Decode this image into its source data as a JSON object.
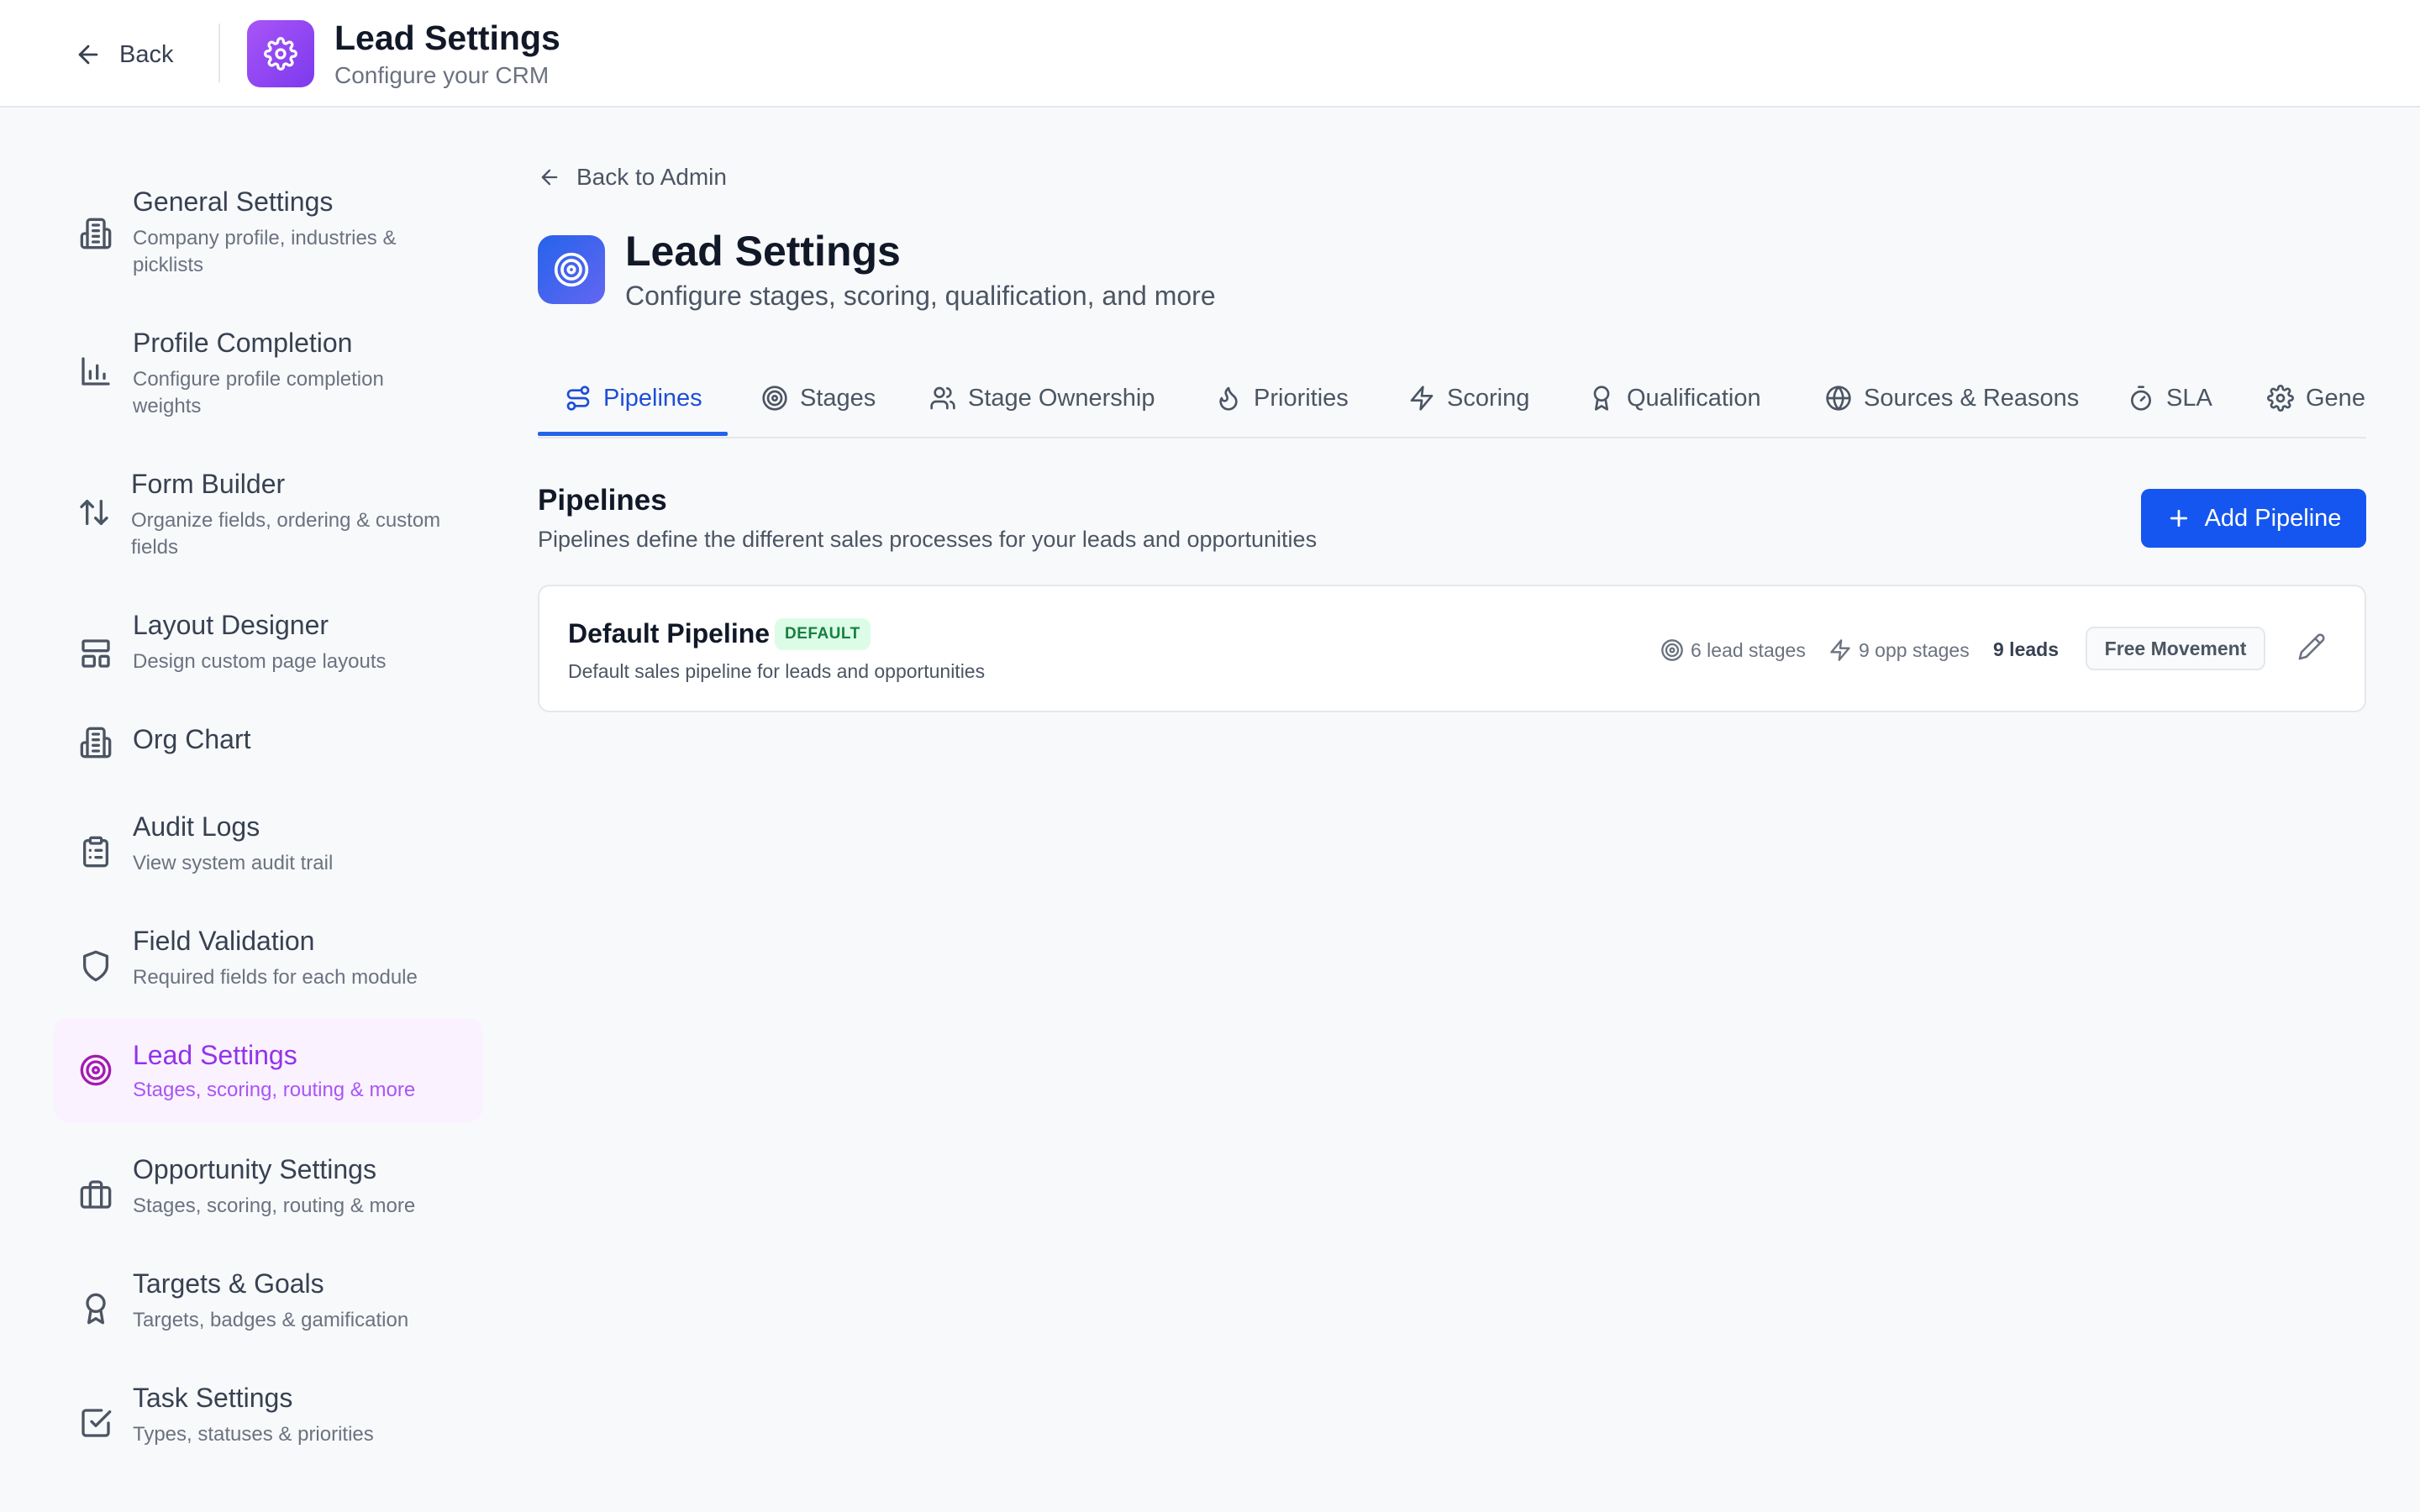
{
  "topbar": {
    "back_label": "Back",
    "app_title": "Lead Settings",
    "app_subtitle": "Configure your CRM",
    "logo_icon": "gear-icon"
  },
  "sidebar": {
    "items": [
      {
        "title": "General Settings",
        "desc": "Company profile, industries & picklists",
        "icon": "building-icon",
        "active": false
      },
      {
        "title": "Profile Completion",
        "desc": "Configure profile completion weights",
        "icon": "bar-chart-icon",
        "active": false
      },
      {
        "title": "Form Builder",
        "desc": "Organize fields, ordering & custom fields",
        "icon": "sort-arrows-icon",
        "active": false
      },
      {
        "title": "Layout Designer",
        "desc": "Design custom page layouts",
        "icon": "layout-icon",
        "active": false
      },
      {
        "title": "Org Chart",
        "desc": "",
        "icon": "building-icon",
        "active": false
      },
      {
        "title": "Audit Logs",
        "desc": "View system audit trail",
        "icon": "clipboard-icon",
        "active": false
      },
      {
        "title": "Field Validation",
        "desc": "Required fields for each module",
        "icon": "shield-icon",
        "active": false
      },
      {
        "title": "Lead Settings",
        "desc": "Stages, scoring, routing & more",
        "icon": "target-icon",
        "active": true
      },
      {
        "title": "Opportunity Settings",
        "desc": "Stages, scoring, routing & more",
        "icon": "briefcase-icon",
        "active": false
      },
      {
        "title": "Targets & Goals",
        "desc": "Targets, badges & gamification",
        "icon": "award-icon",
        "active": false
      },
      {
        "title": "Task Settings",
        "desc": "Types, statuses & priorities",
        "icon": "check-square-icon",
        "active": false
      }
    ]
  },
  "main": {
    "back_admin_label": "Back to Admin",
    "title": "Lead Settings",
    "subtitle": "Configure stages, scoring, qualification, and more",
    "tabs": [
      {
        "label": "Pipelines",
        "icon": "pipeline-icon",
        "active": true
      },
      {
        "label": "Stages",
        "icon": "target-icon",
        "active": false
      },
      {
        "label": "Stage Ownership",
        "icon": "users-icon",
        "active": false
      },
      {
        "label": "Priorities",
        "icon": "flame-icon",
        "active": false
      },
      {
        "label": "Scoring",
        "icon": "zap-icon",
        "active": false
      },
      {
        "label": "Qualification",
        "icon": "award-icon",
        "active": false
      },
      {
        "label": "Sources & Reasons",
        "icon": "globe-icon",
        "active": false
      },
      {
        "label": "SLA",
        "icon": "timer-icon",
        "active": false
      },
      {
        "label": "Gene",
        "icon": "gear-icon",
        "active": false
      }
    ],
    "section": {
      "title": "Pipelines",
      "desc": "Pipelines define the different sales processes for your leads and opportunities",
      "add_label": "Add Pipeline"
    },
    "pipeline": {
      "name": "Default Pipeline",
      "badge": "DEFAULT",
      "desc": "Default sales pipeline for leads and opportunities",
      "lead_stages": "6 lead stages",
      "opp_stages": "9 opp stages",
      "leads": "9 leads",
      "movement": "Free Movement"
    }
  },
  "colors": {
    "primary": "#1556f0",
    "active_purple": "#9333ea",
    "active_bg": "#fbf2ff",
    "badge_bg": "#dcfce7",
    "badge_text": "#15803d"
  }
}
